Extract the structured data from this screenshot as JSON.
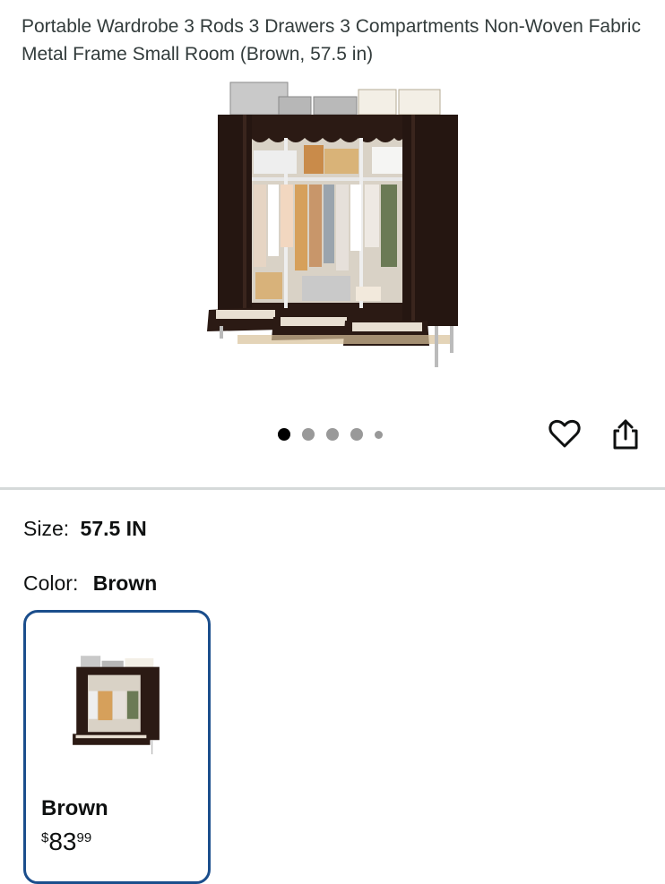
{
  "product": {
    "title": "Portable Wardrobe 3 Rods 3 Drawers 3 Compartments Non-Woven Fabric Metal Frame Small Room (Brown, 57.5 in)"
  },
  "gallery": {
    "image_count": 5,
    "active_index": 0
  },
  "actions": {
    "favorite_icon": "heart-icon",
    "share_icon": "share-icon"
  },
  "size": {
    "label": "Size:",
    "value": "57.5 IN"
  },
  "color": {
    "label": "Color:",
    "value": "Brown"
  },
  "swatch": {
    "name": "Brown",
    "price_symbol": "$",
    "price_whole": "83",
    "price_fraction": "99"
  },
  "colors": {
    "frame": "#2b1a14",
    "swatch_border": "#1b4e8c",
    "divider": "#d5d9d9"
  }
}
